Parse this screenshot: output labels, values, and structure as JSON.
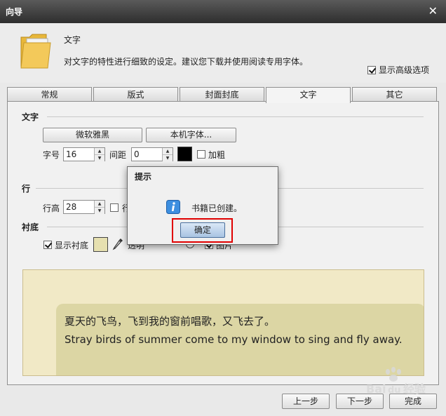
{
  "window": {
    "title": "向导",
    "close_glyph": "✕"
  },
  "header": {
    "title": "文字",
    "description": "对文字的特性进行细致的设定。建议您下载并使用阅读专用字体。",
    "advanced_label": "显示高级选项",
    "advanced_checked": true
  },
  "tabs": [
    {
      "label": "常规",
      "active": false
    },
    {
      "label": "版式",
      "active": false
    },
    {
      "label": "封面封底",
      "active": false
    },
    {
      "label": "文字",
      "active": true
    },
    {
      "label": "其它",
      "active": false
    }
  ],
  "text_section": {
    "heading": "文字",
    "font_button": "微软雅黑",
    "local_font_button": "本机字体...",
    "size_label": "字号",
    "size_value": "16",
    "spacing_label": "间距",
    "spacing_value": "0",
    "text_color": "#000000",
    "bold_label": "加粗"
  },
  "line_section": {
    "heading": "行",
    "line_height_label": "行高",
    "line_height_value": "28",
    "partial_label": "行"
  },
  "background_section": {
    "heading": "衬底",
    "show_bg_label": "显示衬底",
    "show_bg_checked": true,
    "bg_color": "#e6e0b0",
    "transparency_partial": "透明",
    "partial_label": "图片"
  },
  "preview": {
    "line_cn": "夏天的飞鸟，飞到我的窗前唱歌，又飞去了。",
    "line_en": "Stray birds of summer come to my window to sing and fly away."
  },
  "footer": {
    "prev": "上一步",
    "next": "下一步",
    "finish": "完成"
  },
  "dialog": {
    "title": "提示",
    "message": "书籍已创建。",
    "ok": "确定"
  },
  "watermark": {
    "text": "Bai经验"
  }
}
